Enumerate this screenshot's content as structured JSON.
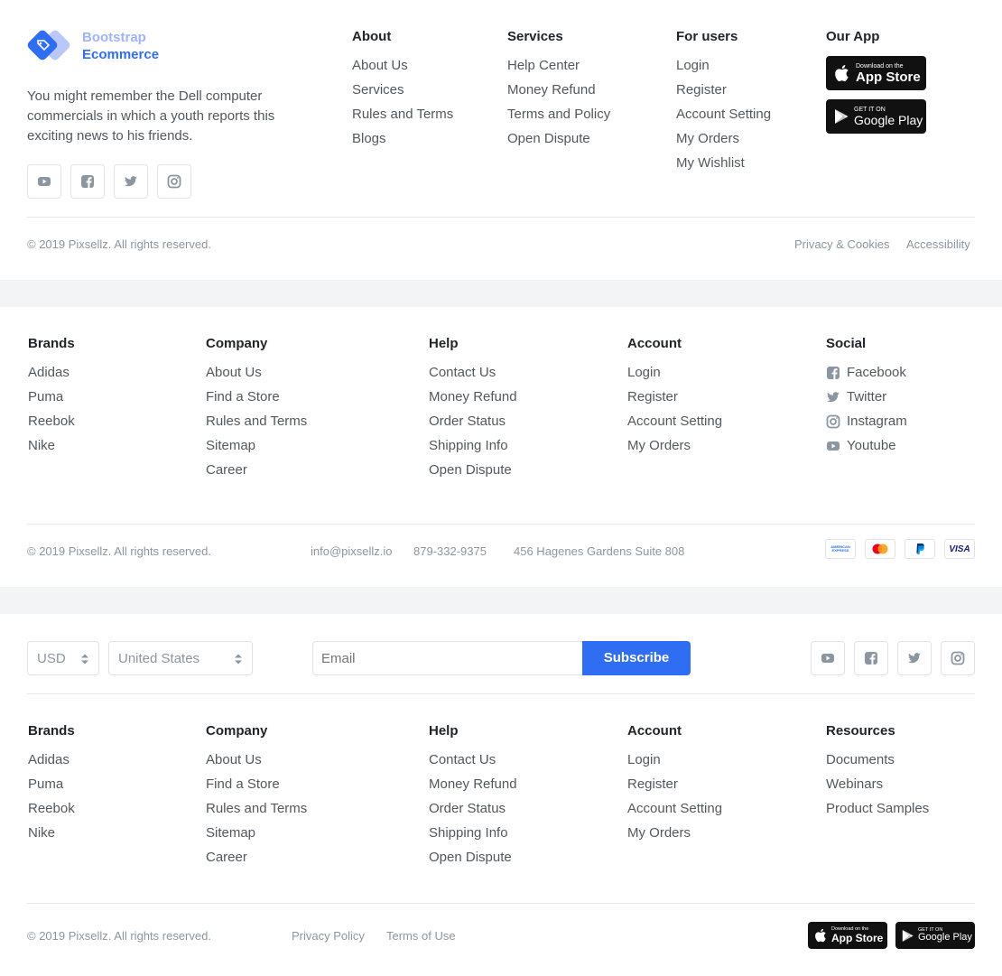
{
  "footer1": {
    "brand": {
      "line1": "Bootstrap",
      "line2": "Ecommerce"
    },
    "description": "You might remember the Dell computer commercials in which a youth reports this exciting news to his friends.",
    "social_icons": [
      "youtube-icon",
      "facebook-icon",
      "twitter-icon",
      "instagram-icon"
    ],
    "columns": [
      {
        "heading": "About",
        "links": [
          "About Us",
          "Services",
          "Rules and Terms",
          "Blogs"
        ]
      },
      {
        "heading": "Services",
        "links": [
          "Help Center",
          "Money Refund",
          "Terms and Policy",
          "Open Dispute"
        ]
      },
      {
        "heading": "For users",
        "links": [
          "Login",
          "Register",
          "Account Setting",
          "My Orders",
          "My Wishlist"
        ]
      }
    ],
    "app_heading": "Our App",
    "app_store": {
      "small": "Download on the",
      "big": "App Store"
    },
    "google_play": {
      "small": "GET IT ON",
      "big": "Google Play"
    },
    "copyright": "© 2019 Pixsellz. All rights reserved.",
    "bottom_links": [
      "Privacy & Cookies",
      "Accessibility"
    ]
  },
  "footer2": {
    "columns": [
      {
        "heading": "Brands",
        "links": [
          "Adidas",
          "Puma",
          "Reebok",
          "Nike"
        ]
      },
      {
        "heading": "Company",
        "links": [
          "About Us",
          "Find a Store",
          "Rules and Terms",
          "Sitemap",
          "Career"
        ]
      },
      {
        "heading": "Help",
        "links": [
          "Contact Us",
          "Money Refund",
          "Order Status",
          "Shipping Info",
          "Open Dispute"
        ]
      },
      {
        "heading": "Account",
        "links": [
          "Login",
          "Register",
          "Account Setting",
          "My Orders"
        ]
      }
    ],
    "social": {
      "heading": "Social",
      "links": [
        {
          "label": "Facebook",
          "icon": "facebook-icon"
        },
        {
          "label": "Twitter",
          "icon": "twitter-icon"
        },
        {
          "label": "Instagram",
          "icon": "instagram-icon"
        },
        {
          "label": "Youtube",
          "icon": "youtube-icon"
        }
      ]
    },
    "copyright": "© 2019 Pixsellz. All rights reserved.",
    "email": "info@pixsellz.io",
    "phone": "879-332-9375",
    "address": "456 Hagenes Gardens Suite 808",
    "payments": [
      "amex-icon",
      "mastercard-icon",
      "paypal-icon",
      "visa-icon"
    ],
    "amex_text": "AMERICAN EXPRESS",
    "visa_text": "VISA"
  },
  "footer3": {
    "currency": "USD",
    "country": "United States",
    "email_placeholder": "Email",
    "subscribe": "Subscribe",
    "social_icons": [
      "youtube-icon",
      "facebook-icon",
      "twitter-icon",
      "instagram-icon"
    ],
    "columns": [
      {
        "heading": "Brands",
        "links": [
          "Adidas",
          "Puma",
          "Reebok",
          "Nike"
        ]
      },
      {
        "heading": "Company",
        "links": [
          "About Us",
          "Find a Store",
          "Rules and Terms",
          "Sitemap",
          "Career"
        ]
      },
      {
        "heading": "Help",
        "links": [
          "Contact Us",
          "Money Refund",
          "Order Status",
          "Shipping Info",
          "Open Dispute"
        ]
      },
      {
        "heading": "Account",
        "links": [
          "Login",
          "Register",
          "Account Setting",
          "My Orders"
        ]
      },
      {
        "heading": "Resources",
        "links": [
          "Documents",
          "Webinars",
          "Product Samples"
        ]
      }
    ],
    "copyright": "© 2019 Pixsellz. All rights reserved.",
    "bottom_links": [
      "Privacy Policy",
      "Terms of Use"
    ],
    "app_store": {
      "small": "Download on the",
      "big": "App Store"
    },
    "google_play": {
      "small": "GET IT ON",
      "big": "Google Play"
    }
  },
  "colors": {
    "accent": "#2f6df2",
    "brand_light": "#9fb4f7",
    "text": "#212529",
    "muted": "#8b96a0"
  }
}
